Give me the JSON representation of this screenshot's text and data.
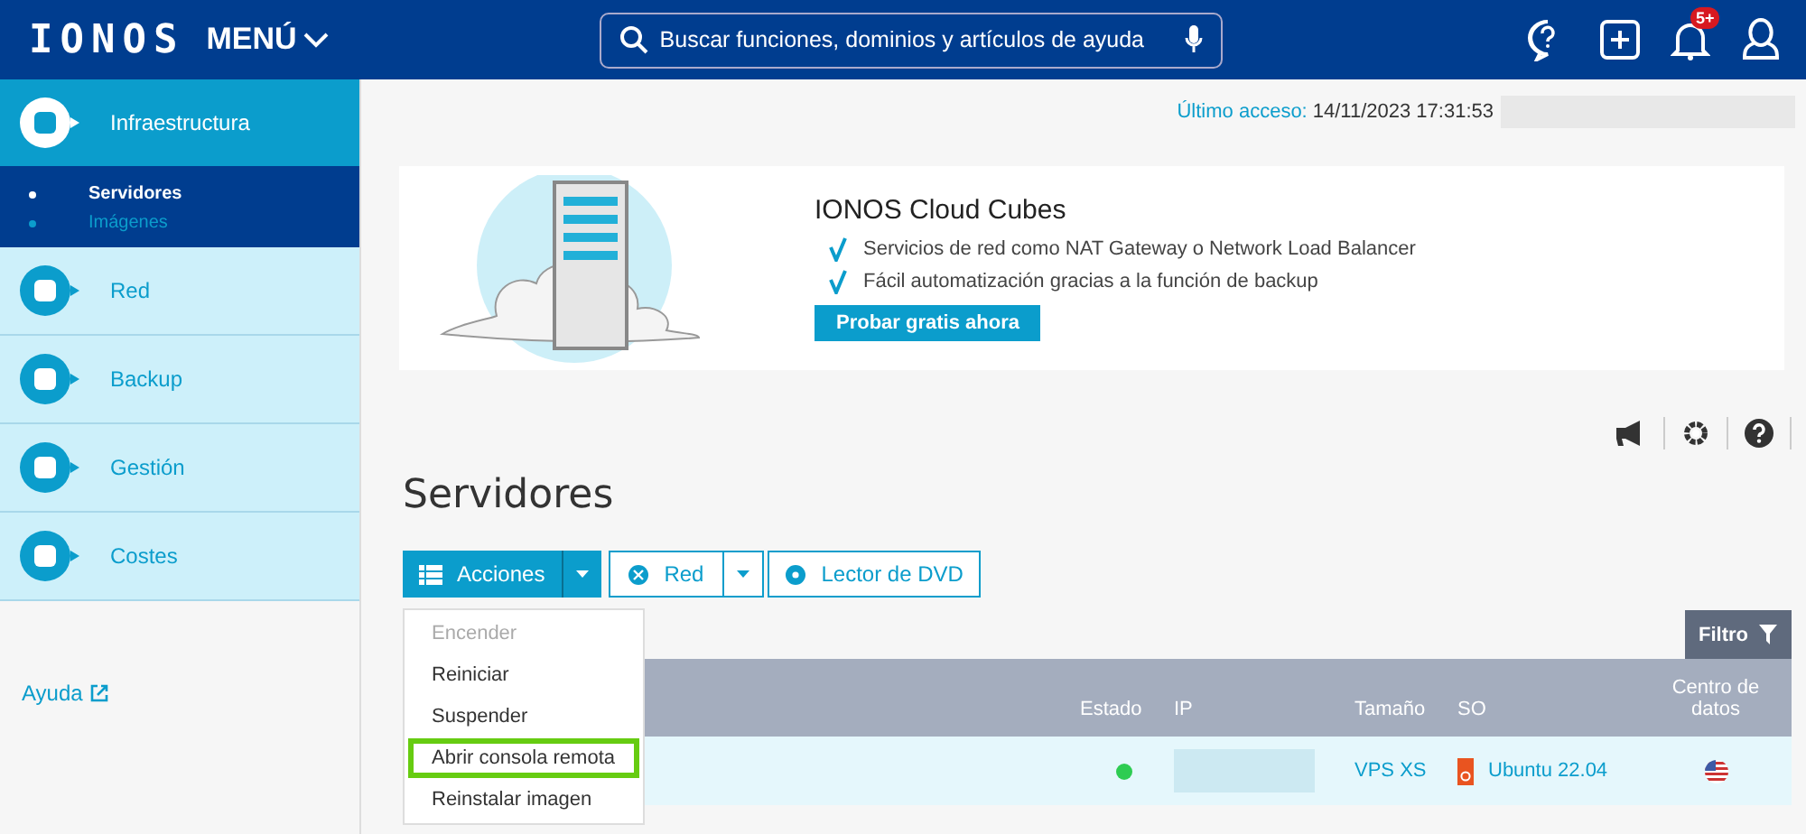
{
  "header": {
    "logo": "IONOS",
    "menu": "MENÚ",
    "search": {
      "placeholder": "Buscar funciones, dominios y artículos de ayuda"
    },
    "badge": "5+"
  },
  "sidebar": {
    "items": [
      {
        "label": "Infraestructura",
        "selected": true,
        "children": [
          {
            "label": "Servidores",
            "selected": true
          },
          {
            "label": "Imágenes",
            "selected": false
          }
        ]
      },
      {
        "label": "Red",
        "selected": false
      },
      {
        "label": "Backup",
        "selected": false
      },
      {
        "label": "Gestión",
        "selected": false
      },
      {
        "label": "Costes",
        "selected": false
      }
    ],
    "help": "Ayuda"
  },
  "last_access": {
    "label": "Último acceso:",
    "value": "14/11/2023 17:31:53"
  },
  "banner": {
    "title": "IONOS Cloud Cubes",
    "features": [
      "Servicios de red como NAT Gateway o Network Load Balancer",
      "Fácil automatización gracias a la función de backup"
    ],
    "button": "Probar gratis ahora"
  },
  "page_title": "Servidores",
  "toolbar": {
    "actions": "Acciones",
    "network": "Red",
    "dvd": "Lector de DVD",
    "filter": "Filtro"
  },
  "actions_menu": [
    {
      "label": "Encender",
      "disabled": true,
      "selected": false
    },
    {
      "label": "Reiniciar",
      "disabled": false,
      "selected": false
    },
    {
      "label": "Suspender",
      "disabled": false,
      "selected": false
    },
    {
      "label": "Abrir consola remota",
      "disabled": false,
      "selected": true
    },
    {
      "label": "Reinstalar imagen",
      "disabled": false,
      "selected": false
    }
  ],
  "table": {
    "columns": [
      "Estado",
      "IP",
      "Tamaño",
      "SO",
      "Centro de datos"
    ],
    "rows": [
      {
        "color": "#2ecc52",
        "size": "VPS XS",
        "os": "Ubuntu 22.04"
      }
    ]
  }
}
